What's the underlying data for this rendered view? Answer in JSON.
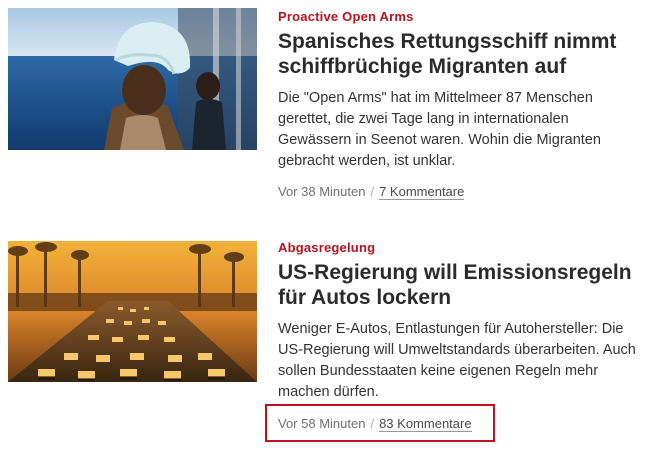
{
  "articles": [
    {
      "kicker": "Proactive Open Arms",
      "headline": "Spanisches Rettungsschiff nimmt schiffbrüchige Migranten auf",
      "summary": "Die \"Open Arms\" hat im Mittelmeer 87 Menschen gerettet, die zwei Tage lang in internationalen Gewässern in Seenot waren. Wohin die Migranten gebracht werden, ist unklar.",
      "time": "Vor 38 Minuten",
      "separator": "/",
      "comments": "7 Kommentare"
    },
    {
      "kicker": "Abgasregelung",
      "headline": "US-Regierung will Emissionsregeln für Autos lockern",
      "summary": "Weniger E-Autos, Entlastungen für Autohersteller: Die US-Regierung will Umweltstandards überarbeiten. Auch sollen Bundesstaaten keine eigenen Regeln mehr machen dürfen.",
      "time": "Vor 58 Minuten",
      "separator": "/",
      "comments": "83 Kommentare"
    }
  ],
  "colors": {
    "kicker": "#b4131f",
    "highlight_box": "#c0101f"
  }
}
